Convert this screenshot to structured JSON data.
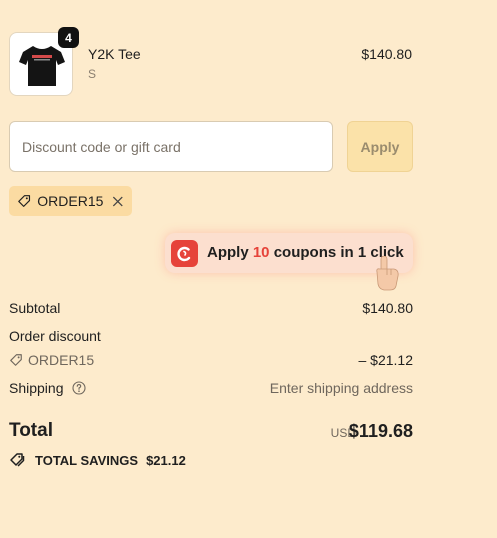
{
  "product": {
    "name": "Y2K Tee",
    "variant": "S",
    "price": "$140.80",
    "quantity": "4",
    "image_icon": "black-tshirt-icon"
  },
  "discount": {
    "placeholder": "Discount code or gift card",
    "value": "",
    "apply_label": "Apply",
    "applied_code": "ORDER15"
  },
  "promo": {
    "prefix": "Apply ",
    "count": "10",
    "suffix": " coupons in 1 click",
    "logo_icon": "coupon-app-logo-icon",
    "accent_color": "#e6433a"
  },
  "summary": {
    "subtotal_label": "Subtotal",
    "subtotal_value": "$140.80",
    "order_discount_label": "Order discount",
    "discount_code": "ORDER15",
    "discount_value": "– $21.12",
    "shipping_label": "Shipping",
    "shipping_value": "Enter shipping address",
    "total_label": "Total",
    "total_currency": "USD",
    "total_value": "$119.68",
    "savings_label": "TOTAL SAVINGS",
    "savings_value": "$21.12"
  },
  "colors": {
    "background": "#fdebcc",
    "tag_background": "#fbdba2",
    "apply_button": "#fbe2a9"
  }
}
